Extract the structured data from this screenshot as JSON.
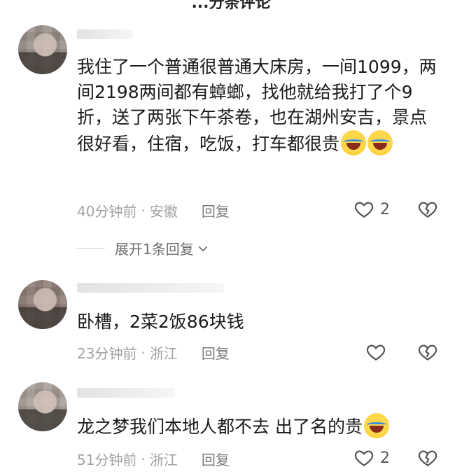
{
  "header": {
    "title": "...分条评论"
  },
  "comments": [
    {
      "text": "我住了一个普通很普通大床房，一间1099，两间2198两间都有蟑螂，找他就给我打了个9折，送了两张下午茶卷，也在湖州安吉，景点很好看，住宿，吃饭，打车都很贵",
      "time": "40分钟前",
      "location": "安徽",
      "reply_label": "回复",
      "likes": "2",
      "emoji": "crying-laughing-emoji"
    },
    {
      "text": "卧槽，2菜2饭86块钱",
      "time": "23分钟前",
      "location": "浙江",
      "reply_label": "回复",
      "likes": ""
    },
    {
      "text": "龙之梦我们本地人都不去 出了名的贵",
      "time": "51分钟前",
      "location": "浙江",
      "reply_label": "回复",
      "likes": "2",
      "emoji": "crying-laughing-emoji"
    }
  ],
  "expand_replies": {
    "label": "展开1条回复"
  },
  "icons": {
    "like": "heart-outline-icon",
    "dislike": "broken-heart-icon",
    "expand": "chevron-down-icon"
  },
  "colors": {
    "meta": "#a2a2a2",
    "text": "#1a1a1a",
    "icon": "#555555"
  }
}
